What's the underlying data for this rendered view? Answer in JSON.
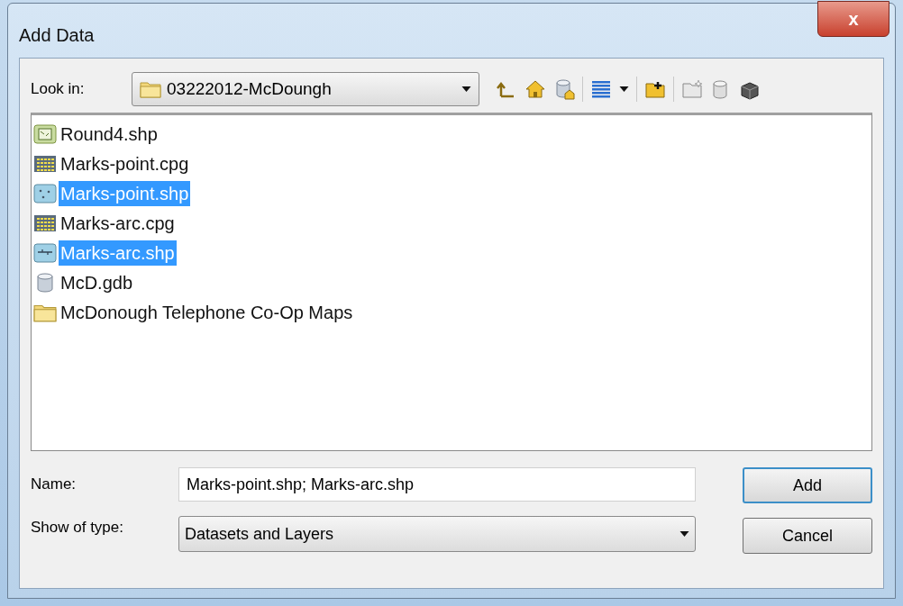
{
  "window": {
    "title": "Add Data",
    "close_label": "x"
  },
  "look_in": {
    "label": "Look in:",
    "value": "03222012-McDoungh"
  },
  "files": [
    {
      "name": "Round4.shp",
      "kind": "raster",
      "selected": false
    },
    {
      "name": "Marks-point.cpg",
      "kind": "table",
      "selected": false
    },
    {
      "name": "Marks-point.shp",
      "kind": "point",
      "selected": true
    },
    {
      "name": "Marks-arc.cpg",
      "kind": "table",
      "selected": false
    },
    {
      "name": "Marks-arc.shp",
      "kind": "line",
      "selected": true
    },
    {
      "name": "McD.gdb",
      "kind": "gdb",
      "selected": false
    },
    {
      "name": "McDonough Telephone Co-Op Maps",
      "kind": "folder",
      "selected": false
    }
  ],
  "name_field": {
    "label": "Name:",
    "value": "Marks-point.shp; Marks-arc.shp"
  },
  "type_field": {
    "label": "Show of type:",
    "value": "Datasets and Layers"
  },
  "buttons": [
    "Add",
    "Cancel"
  ]
}
